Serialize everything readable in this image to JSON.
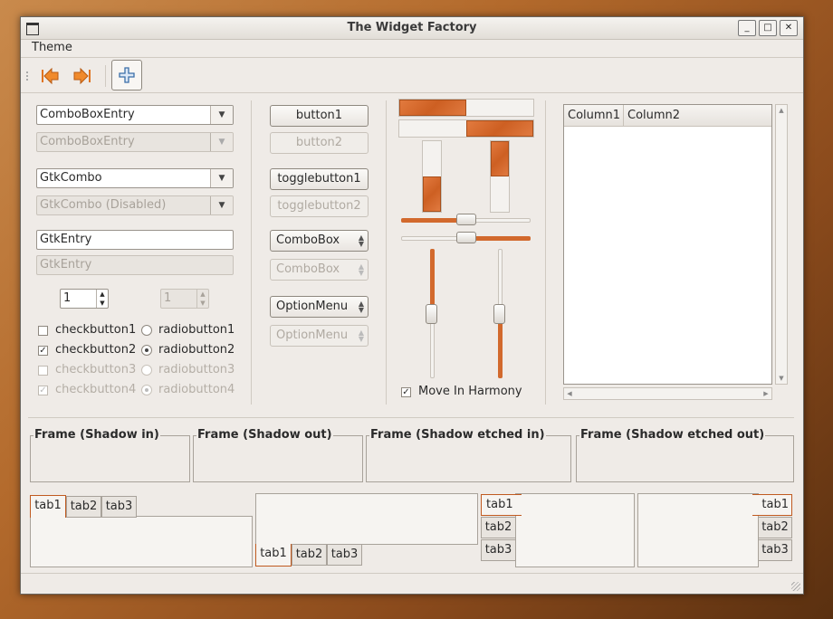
{
  "window": {
    "title": "The Widget Factory",
    "controls": [
      "_",
      "□",
      "✕"
    ]
  },
  "menubar": {
    "items": [
      "Theme"
    ]
  },
  "toolbar": {
    "buttons": [
      "go-back-icon",
      "go-forward-icon",
      "add-icon"
    ]
  },
  "col1": {
    "combo_entry": "ComboBoxEntry",
    "combo_entry_disabled": "ComboBoxEntry",
    "gtk_combo": "GtkCombo",
    "gtk_combo_disabled": "GtkCombo (Disabled)",
    "entry": "GtkEntry",
    "entry_disabled": "GtkEntry",
    "spin_value": "1",
    "spin_value_disabled": "1",
    "check1": "checkbutton1",
    "check2": "checkbutton2",
    "check3": "checkbutton3",
    "check4": "checkbutton4",
    "radio1": "radiobutton1",
    "radio2": "radiobutton2",
    "radio3": "radiobutton3",
    "radio4": "radiobutton4",
    "check_mark": "✓"
  },
  "col2": {
    "button1": "button1",
    "button2": "button2",
    "toggle1": "togglebutton1",
    "toggle2": "togglebutton2",
    "combobox": "ComboBox",
    "combobox_disabled": "ComboBox",
    "optionmenu": "OptionMenu",
    "optionmenu_disabled": "OptionMenu"
  },
  "col3": {
    "progress_h1": 0.5,
    "progress_h2": 0.5,
    "progress_v1": 0.5,
    "progress_v2": 0.5,
    "hscale1": 0.5,
    "hscale2": 0.5,
    "vscale1": 0.5,
    "vscale2": 0.5,
    "harmony_label": "Move In Harmony",
    "harmony_checked": true
  },
  "tree": {
    "columns": [
      "Column1",
      "Column2"
    ]
  },
  "frames": [
    {
      "label": "Frame (Shadow in)"
    },
    {
      "label": "Frame (Shadow out)"
    },
    {
      "label": "Frame (Shadow etched in)"
    },
    {
      "label": "Frame (Shadow etched out)"
    }
  ],
  "notebooks": {
    "tabs": [
      "tab1",
      "tab2",
      "tab3"
    ]
  },
  "colors": {
    "accent": "#d2692d",
    "window_bg": "#efebe7"
  }
}
